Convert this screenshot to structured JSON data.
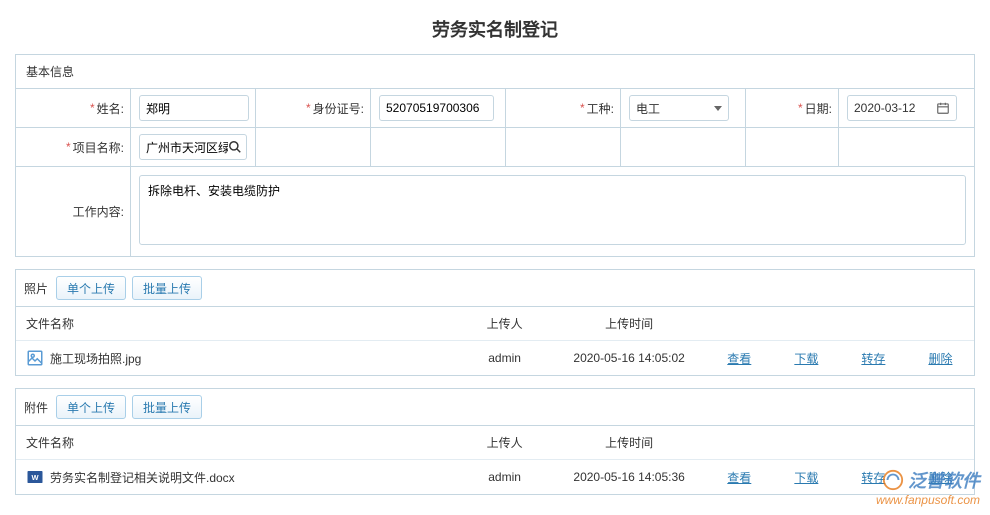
{
  "title": "劳务实名制登记",
  "basic": {
    "section": "基本信息",
    "name_label": "姓名:",
    "name_value": "郑明",
    "idcard_label": "身份证号:",
    "idcard_value": "52070519700306",
    "worktype_label": "工种:",
    "worktype_value": "电工",
    "date_label": "日期:",
    "date_value": "2020-03-12",
    "project_label": "项目名称:",
    "project_value": "广州市天河区绿",
    "content_label": "工作内容:",
    "content_value": "拆除电杆、安装电缆防护"
  },
  "photos": {
    "section": "照片",
    "upload_single": "单个上传",
    "upload_batch": "批量上传",
    "cols": {
      "filename": "文件名称",
      "uploader": "上传人",
      "time": "上传时间"
    },
    "rows": [
      {
        "filename": "施工现场拍照.jpg",
        "uploader": "admin",
        "time": "2020-05-16 14:05:02"
      }
    ],
    "actions": {
      "view": "查看",
      "download": "下载",
      "transfer": "转存",
      "delete": "删除"
    }
  },
  "attachments": {
    "section": "附件",
    "upload_single": "单个上传",
    "upload_batch": "批量上传",
    "cols": {
      "filename": "文件名称",
      "uploader": "上传人",
      "time": "上传时间"
    },
    "rows": [
      {
        "filename": "劳务实名制登记相关说明文件.docx",
        "uploader": "admin",
        "time": "2020-05-16 14:05:36"
      }
    ],
    "actions": {
      "view": "查看",
      "download": "下载",
      "transfer": "转存",
      "delete": "删除"
    }
  },
  "watermark": {
    "brand": "泛普软件",
    "url": "www.fanpusoft.com"
  }
}
